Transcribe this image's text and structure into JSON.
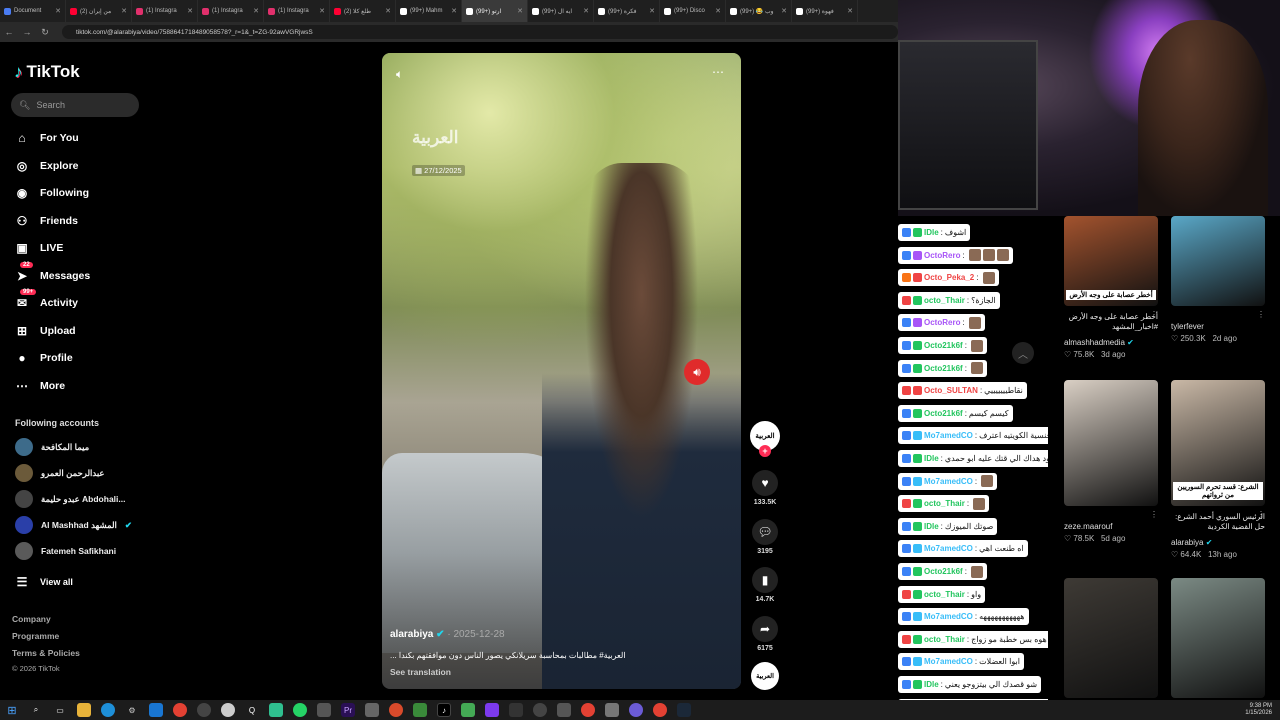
{
  "browser": {
    "tabs": [
      {
        "label": "Document",
        "active": false,
        "color": "#4a7cf3"
      },
      {
        "label": "(2) من إيران",
        "active": false,
        "color": "#ff0033"
      },
      {
        "label": "(1) Instagra",
        "active": false,
        "color": "#e1306c"
      },
      {
        "label": "(1) Instagra",
        "active": false,
        "color": "#e1306c"
      },
      {
        "label": "(1) Instagra",
        "active": false,
        "color": "#e1306c"
      },
      {
        "label": "(2) طلع كلا",
        "active": false,
        "color": "#ff0033"
      },
      {
        "label": "(99+) Mahm",
        "active": false,
        "color": "#ffffff"
      },
      {
        "label": "(99+) ارتو",
        "active": true,
        "color": "#ffffff"
      },
      {
        "label": "(99+) ايه ال",
        "active": false,
        "color": "#ffffff"
      },
      {
        "label": "(99+) فكرة",
        "active": false,
        "color": "#ffffff"
      },
      {
        "label": "(99+) Disco",
        "active": false,
        "color": "#ffffff"
      },
      {
        "label": "(99+) 😂 وب",
        "active": false,
        "color": "#ffffff"
      },
      {
        "label": "(99+) فهوة",
        "active": false,
        "color": "#ffffff"
      }
    ],
    "url": "tiktok.com/@alarabiya/video/7588641718489058578?_r=1&_t=ZG-92awVGRjwsS"
  },
  "sidebar": {
    "logo": "TikTok",
    "search_placeholder": "Search",
    "nav": [
      {
        "label": "For You",
        "icon": "home-icon",
        "glyph": "⌂"
      },
      {
        "label": "Explore",
        "icon": "compass-icon",
        "glyph": "◎"
      },
      {
        "label": "Following",
        "icon": "following-avatar-icon",
        "glyph": "◉"
      },
      {
        "label": "Friends",
        "icon": "friends-icon",
        "glyph": "⚇"
      },
      {
        "label": "LIVE",
        "icon": "live-icon",
        "glyph": "▣"
      },
      {
        "label": "Messages",
        "icon": "messages-icon",
        "glyph": "➤",
        "badge": "22"
      },
      {
        "label": "Activity",
        "icon": "activity-icon",
        "glyph": "✉",
        "badge": "99+"
      },
      {
        "label": "Upload",
        "icon": "upload-icon",
        "glyph": "⊞"
      },
      {
        "label": "Profile",
        "icon": "profile-avatar-icon",
        "glyph": "●"
      },
      {
        "label": "More",
        "icon": "more-dots-icon",
        "glyph": "⋯"
      }
    ],
    "following_title": "Following accounts",
    "accounts": [
      {
        "name": "ميما المكافحة"
      },
      {
        "name": "عبدالرحمن العمرو"
      },
      {
        "name": "عبدو حليمة Abdohali..."
      },
      {
        "name": "Al Mashhad المشهد",
        "verified": true
      },
      {
        "name": "Fatemeh Safikhani"
      }
    ],
    "view_all": "View all",
    "footer": [
      "Company",
      "Programme",
      "Terms & Policies"
    ],
    "copyright": "© 2026 TikTok"
  },
  "video": {
    "watermark": "العربية",
    "date_overlay": "27/12/2025",
    "author": "alarabiya",
    "post_date": "2025-12-28",
    "caption": "العربية# مطالبات بمحاسبة سريلانكي يصور الناس دون موافقتهم بكندا ...",
    "see_translation": "See translation"
  },
  "actions": {
    "avatar_text": "العربية",
    "likes": "133.5K",
    "comments": "3195",
    "saves": "14.7K",
    "shares": "6175"
  },
  "chat": [
    {
      "user": "IDle",
      "text": "اشوف",
      "c1": "#3b82f6",
      "c2": "#22c55e"
    },
    {
      "user": "OctoRero",
      "text": "",
      "c1": "#3b82f6",
      "c2": "#a855f7",
      "emotes": 3
    },
    {
      "user": "Octo_Peka_2",
      "text": "",
      "c1": "#f97316",
      "c2": "#ef4444",
      "emotes": 1
    },
    {
      "user": "octo_Thair",
      "text": "الجازة؟",
      "c1": "#ef4444",
      "c2": "#22c55e"
    },
    {
      "user": "OctoRero",
      "text": "",
      "c1": "#3b82f6",
      "c2": "#a855f7",
      "emotes": 1
    },
    {
      "user": "Octo21k6f",
      "text": "",
      "c1": "#3b82f6",
      "c2": "#22c55e",
      "emotes": 1
    },
    {
      "user": "Octo21k6f",
      "text": "",
      "c1": "#3b82f6",
      "c2": "#22c55e",
      "emotes": 1
    },
    {
      "user": "Octo_SULTAN",
      "text": "نقاطيييييييي",
      "c1": "#ef4444",
      "c2": "#ef4444"
    },
    {
      "user": "Octo21k6f",
      "text": "كيسم كيسم",
      "c1": "#3b82f6",
      "c2": "#22c55e"
    },
    {
      "user": "Mo7amedCO",
      "text": "ايه موضوع جوازك العرقي من الجنسية الكويتيه اعترف",
      "c1": "#3b82f6",
      "c2": "#38bdf8"
    },
    {
      "user": "IDle",
      "text": "خود هداك الي قتك عليه ابو حمدي",
      "c1": "#3b82f6",
      "c2": "#22c55e"
    },
    {
      "user": "Mo7amedCO",
      "text": "",
      "c1": "#3b82f6",
      "c2": "#38bdf8",
      "emotes": 1
    },
    {
      "user": "octo_Thair",
      "text": "",
      "c1": "#ef4444",
      "c2": "#22c55e",
      "emotes": 1
    },
    {
      "user": "IDle",
      "text": "صوتك الميوزك",
      "c1": "#3b82f6",
      "c2": "#22c55e"
    },
    {
      "user": "Mo7amedCO",
      "text": "اه طنعت اهي",
      "c1": "#3b82f6",
      "c2": "#38bdf8"
    },
    {
      "user": "Octo21k6f",
      "text": "",
      "c1": "#3b82f6",
      "c2": "#22c55e",
      "emotes": 1
    },
    {
      "user": "octo_Thair",
      "text": "واو",
      "c1": "#ef4444",
      "c2": "#22c55e"
    },
    {
      "user": "Mo7amedCO",
      "text": "هههههههههههه",
      "c1": "#3b82f6",
      "c2": "#38bdf8"
    },
    {
      "user": "octo_Thair",
      "text": "هوه بس خطبة مو زواج",
      "c1": "#ef4444",
      "c2": "#22c55e"
    },
    {
      "user": "Mo7amedCO",
      "text": "ابوا العضلات",
      "c1": "#3b82f6",
      "c2": "#38bdf8"
    },
    {
      "user": "IDle",
      "text": "شو قصدك الي بيتزوجو يعني",
      "c1": "#3b82f6",
      "c2": "#22c55e"
    },
    {
      "user": "Mo7amedCO",
      "text": "بودي جارد من سوق الخميس",
      "c1": "#3b82f6",
      "c2": "#38bdf8"
    }
  ],
  "recommended": [
    {
      "title": "أخطر عصابة على وجه الأرض #اخبار_المشهد",
      "user": "almashhadmedia",
      "verified": true,
      "likes": "75.8K",
      "age": "3d ago",
      "thumb_caption": "أخطر عصابة على وجه الأرض",
      "thumb": "#a3532e"
    },
    {
      "title": "",
      "user": "tylerfever",
      "verified": false,
      "likes": "250.3K",
      "age": "2d ago",
      "thumb_caption": "",
      "thumb": "#5aa8c8"
    },
    {
      "title": "",
      "user": "zeze.maarouf",
      "verified": false,
      "likes": "78.5K",
      "age": "5d ago",
      "thumb_caption": "",
      "thumb": "#d9cfc4"
    },
    {
      "title": "الرئيس السوري أحمد الشرع: حل القضية الكردية",
      "user": "alarabiya",
      "verified": true,
      "likes": "64.4K",
      "age": "13h ago",
      "thumb_caption": "الشرع: قسد تحرم السوريين من ثرواتهم",
      "thumb": "#c9b8a6"
    },
    {
      "title": "",
      "user": "",
      "verified": false,
      "likes": "",
      "age": "",
      "thumb_caption": "",
      "thumb": "#3e3a35"
    },
    {
      "title": "",
      "user": "",
      "verified": false,
      "likes": "",
      "age": "",
      "thumb_caption": "",
      "thumb": "#7b8a84"
    }
  ],
  "taskbar": {
    "time": "9:38 PM",
    "date": "1/15/2026"
  }
}
